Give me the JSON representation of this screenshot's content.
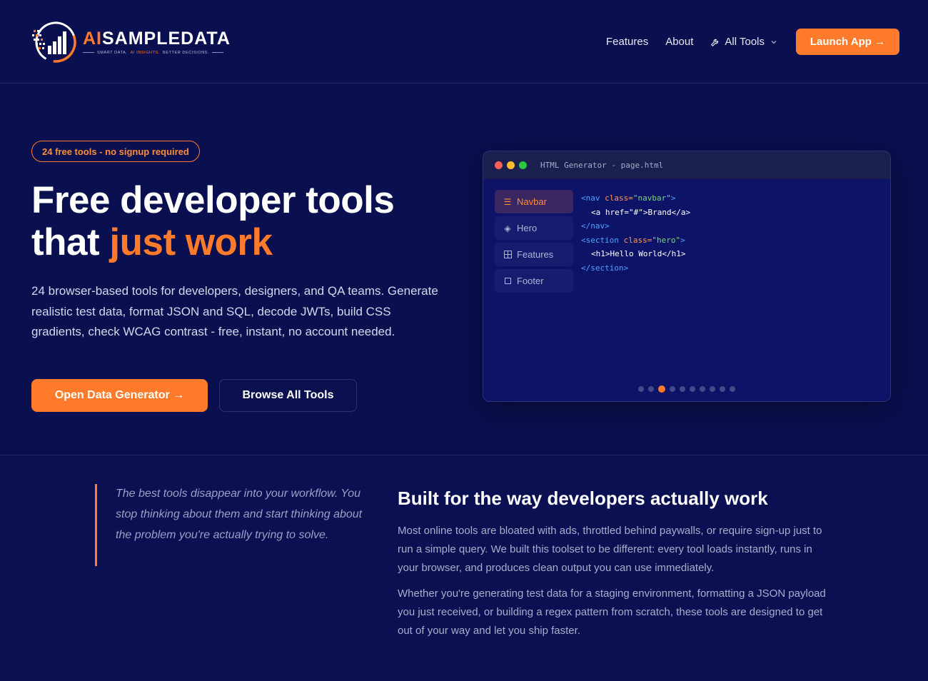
{
  "brand": {
    "name_ai": "AI",
    "name_rest": "SAMPLEDATA",
    "tagline_part1": "SMART DATA.",
    "tagline_part2": "AI INSIGHTS.",
    "tagline_part3": "BETTER DECISIONS.",
    "accent_color": "#ff7a2a",
    "background_color": "#0a0f4f"
  },
  "nav": {
    "features": "Features",
    "about": "About",
    "all_tools": "All Tools",
    "launch": "Launch App →"
  },
  "hero": {
    "badge": "24 free tools - no signup required",
    "title_line1": "Free developer tools",
    "title_that": "that ",
    "title_accent": "just work",
    "description": "24 browser-based tools for developers, designers, and QA teams. Generate realistic test data, format JSON and SQL, decode JWTs, build CSS gradients, check WCAG contrast - free, instant, no account needed.",
    "primary_button": "Open Data Generator →",
    "secondary_button": "Browse All Tools"
  },
  "preview": {
    "window_title": "HTML Generator - page.html",
    "sidebar": [
      {
        "label": "Navbar",
        "icon": "menu-icon"
      },
      {
        "label": "Hero",
        "icon": "diamond-icon"
      },
      {
        "label": "Features",
        "icon": "grid-icon"
      },
      {
        "label": "Footer",
        "icon": "square-icon"
      }
    ],
    "active_index": 0,
    "code": {
      "l1_open": "<nav",
      "l1_attr": " class=",
      "l1_str": "\"navbar\"",
      "l1_close": ">",
      "l2_text": "<a href=\"#\">Brand</a>",
      "l3": "</nav>",
      "l4_open": "<section",
      "l4_attr": " class=",
      "l4_str": "\"hero\"",
      "l4_close": ">",
      "l5_text": "<h1>Hello World</h1>",
      "l6": "</section>"
    },
    "pager_total": 10,
    "pager_active": 2
  },
  "about": {
    "quote": "The best tools disappear into your workflow. You stop thinking about them and start thinking about the problem you're actually trying to solve.",
    "title": "Built for the way developers actually work",
    "p1": "Most online tools are bloated with ads, throttled behind paywalls, or require sign-up just to run a simple query. We built this toolset to be different: every tool loads instantly, runs in your browser, and produces clean output you can use immediately.",
    "p2": "Whether you're generating test data for a staging environment, formatting a JSON payload you just received, or building a regex pattern from scratch, these tools are designed to get out of your way and let you ship faster."
  }
}
